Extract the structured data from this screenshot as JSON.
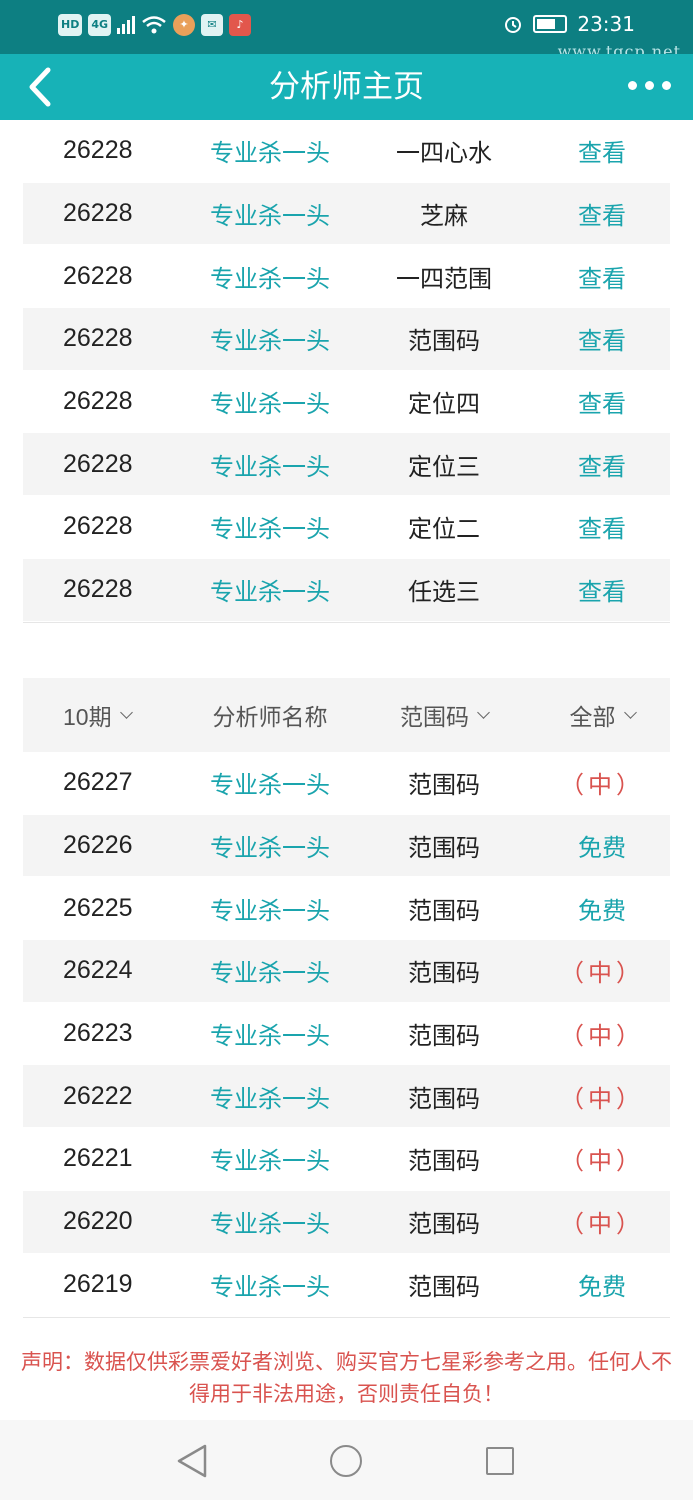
{
  "status_bar": {
    "chips": [
      "HD",
      "4G"
    ],
    "time": "23:31",
    "watermark": "www.tqcp.net"
  },
  "nav": {
    "title": "分析师主页"
  },
  "upper_table": {
    "rows": [
      {
        "issue": "26228",
        "analyst": "专业杀一头",
        "type": "一四心水",
        "action": "查看"
      },
      {
        "issue": "26228",
        "analyst": "专业杀一头",
        "type": "芝麻",
        "action": "查看"
      },
      {
        "issue": "26228",
        "analyst": "专业杀一头",
        "type": "一四范围",
        "action": "查看"
      },
      {
        "issue": "26228",
        "analyst": "专业杀一头",
        "type": "范围码",
        "action": "查看"
      },
      {
        "issue": "26228",
        "analyst": "专业杀一头",
        "type": "定位四",
        "action": "查看"
      },
      {
        "issue": "26228",
        "analyst": "专业杀一头",
        "type": "定位三",
        "action": "查看"
      },
      {
        "issue": "26228",
        "analyst": "专业杀一头",
        "type": "定位二",
        "action": "查看"
      },
      {
        "issue": "26228",
        "analyst": "专业杀一头",
        "type": "任选三",
        "action": "查看"
      }
    ]
  },
  "filters": {
    "period": "10期",
    "analyst_col": "分析师名称",
    "type": "范围码",
    "result": "全部"
  },
  "history_table": {
    "rows": [
      {
        "issue": "26227",
        "analyst": "专业杀一头",
        "type": "范围码",
        "result": "（中）",
        "hit": true
      },
      {
        "issue": "26226",
        "analyst": "专业杀一头",
        "type": "范围码",
        "result": "免费",
        "hit": false
      },
      {
        "issue": "26225",
        "analyst": "专业杀一头",
        "type": "范围码",
        "result": "免费",
        "hit": false
      },
      {
        "issue": "26224",
        "analyst": "专业杀一头",
        "type": "范围码",
        "result": "（中）",
        "hit": true
      },
      {
        "issue": "26223",
        "analyst": "专业杀一头",
        "type": "范围码",
        "result": "（中）",
        "hit": true
      },
      {
        "issue": "26222",
        "analyst": "专业杀一头",
        "type": "范围码",
        "result": "（中）",
        "hit": true
      },
      {
        "issue": "26221",
        "analyst": "专业杀一头",
        "type": "范围码",
        "result": "（中）",
        "hit": true
      },
      {
        "issue": "26220",
        "analyst": "专业杀一头",
        "type": "范围码",
        "result": "（中）",
        "hit": true
      },
      {
        "issue": "26219",
        "analyst": "专业杀一头",
        "type": "范围码",
        "result": "免费",
        "hit": false
      }
    ]
  },
  "disclaimer": "声明：数据仅供彩票爱好者浏览、购买官方七星彩参考之用。任何人不得用于非法用途，否则责任自负！",
  "colors": {
    "status_bar": "#0d7f82",
    "nav_bar": "#17b2b7",
    "link": "#1aa4ad",
    "hit": "#d9534f"
  }
}
